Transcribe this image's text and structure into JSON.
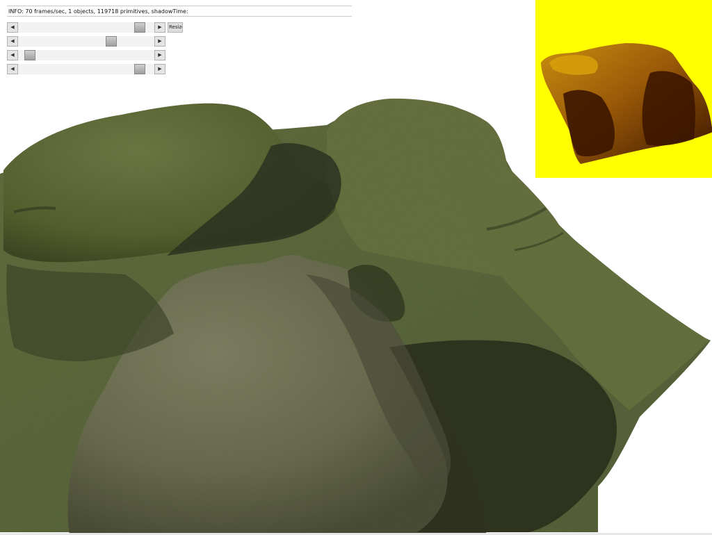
{
  "info": {
    "text": "INFO: 70 frames/sec, 1 objects, 119718 primitives, shadowTime:"
  },
  "controls": {
    "resize_label": "Resize",
    "sliders": [
      {
        "name": "slider-1",
        "value": 0.93
      },
      {
        "name": "slider-2",
        "value": 0.7
      },
      {
        "name": "slider-3",
        "value": 0.05
      },
      {
        "name": "slider-4",
        "value": 0.93
      }
    ],
    "arrow_left": "◀",
    "arrow_right": "▶"
  },
  "colors": {
    "shadow_map_bg": "#ffff00",
    "grass": "#5e6b3a",
    "rock": "#6f7157",
    "shadow": "#2d3320",
    "sand": "#d9d2bd"
  },
  "icons": {
    "arrow_left": "left-arrow-icon",
    "arrow_right": "right-arrow-icon"
  }
}
